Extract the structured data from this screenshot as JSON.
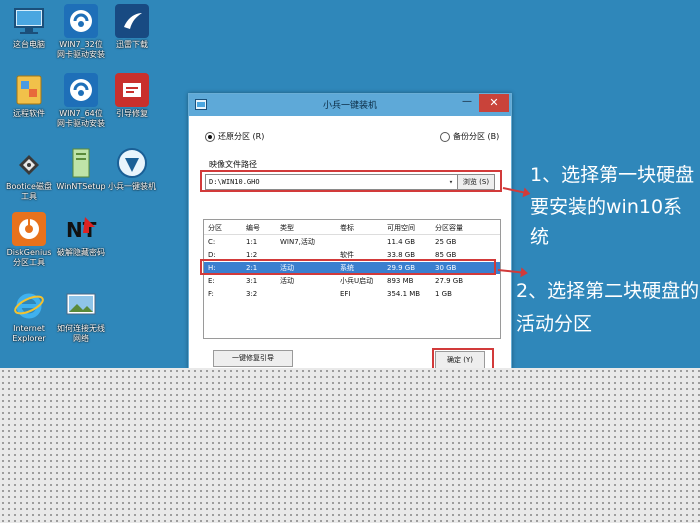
{
  "desktop": {
    "icons": [
      {
        "label": "这台电脑",
        "icon": "computer-icon"
      },
      {
        "label": "WIN7_32位\n网卡驱动安装",
        "icon": "network-driver-icon"
      },
      {
        "label": "迅雷下载",
        "icon": "thunder-download-icon"
      },
      {
        "label": "远程软件",
        "icon": "remote-software-icon"
      },
      {
        "label": "WIN7_64位\n网卡驱动安装",
        "icon": "network-driver-icon"
      },
      {
        "label": "引导修复",
        "icon": "boot-repair-icon"
      },
      {
        "label": "Bootice磁盘\n工具",
        "icon": "bootice-icon"
      },
      {
        "label": "WinNTSetup",
        "icon": "winntsetup-icon"
      },
      {
        "label": "小兵一键装机",
        "icon": "xiaobing-install-icon"
      },
      {
        "label": "DiskGenius\n分区工具",
        "icon": "diskgenius-icon"
      },
      {
        "label": "破解隐藏密码",
        "icon": "password-crack-icon"
      },
      {
        "label": "Internet\nExplorer",
        "icon": "internet-explorer-icon"
      },
      {
        "label": "如何连接无线\n网络",
        "icon": "wifi-help-icon"
      }
    ]
  },
  "window": {
    "title": "小兵一键装机",
    "close": "✕",
    "minimize": "—",
    "radio_restore": "还原分区 (R)",
    "radio_backup": "备份分区 (B)",
    "path_label": "映像文件路径",
    "path_value": "D:\\WIN10.GHO",
    "browse_label": "浏览 (S)",
    "table": {
      "headers": [
        "分区",
        "编号",
        "类型",
        "卷标",
        "可用空间",
        "分区容量"
      ],
      "rows": [
        [
          "C:",
          "1:1",
          "WIN7,活动",
          "",
          "11.4 GB",
          "25 GB"
        ],
        [
          "D:",
          "1:2",
          "",
          "软件",
          "33.8 GB",
          "85 GB"
        ],
        [
          "H:",
          "2:1",
          "活动",
          "系统",
          "29.9 GB",
          "30 GB"
        ],
        [
          "E:",
          "3:1",
          "活动",
          "小兵U启动",
          "893 MB",
          "27.9 GB"
        ],
        [
          "F:",
          "3:2",
          "",
          "EFI",
          "354.1 MB",
          "1 GB"
        ]
      ],
      "selected_row": 2
    },
    "repair_label": "一键修复引导",
    "ok_label": "确定 (Y)"
  },
  "annotations": {
    "step1_line1": "1、选择第一块硬盘",
    "step1_line2": "要安装的win10系统",
    "step2_line1": "2、选择第二块硬盘的",
    "step2_line2": "活动分区"
  },
  "colors": {
    "desktop": "#2f87ba",
    "highlight": "#d23a3a",
    "selection": "#3a7fcf"
  }
}
